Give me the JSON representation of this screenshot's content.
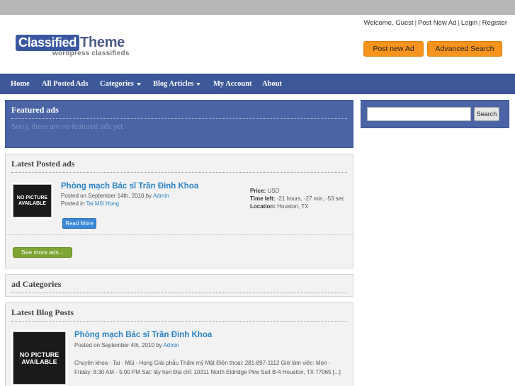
{
  "header": {
    "welcome": "Welcome, Guest",
    "links": [
      "Post New Ad",
      "Login",
      "Register"
    ],
    "logo_box": "Classified",
    "logo_word": "Theme",
    "logo_sub": "wordpress classifieds",
    "btn_post": "Post new Ad",
    "btn_advanced": "Advanced Search"
  },
  "nav": {
    "items": [
      {
        "label": "Home"
      },
      {
        "label": "All Posted Ads"
      },
      {
        "label": "Categories"
      },
      {
        "label": "Blog Articles"
      },
      {
        "label": "My Account"
      },
      {
        "label": "About"
      }
    ]
  },
  "featured": {
    "title": "Featured ads",
    "message": "Sorry, there are no featured ads yet."
  },
  "latest": {
    "title": "Latest Posted ads",
    "thumb": "NO PICTURE AVAILABLE",
    "ad_title": "Phòng mạch Bác sĩ Trần Đình Khoa",
    "posted_prefix": "Posted on September 14th, 2010 by ",
    "author": "Admin",
    "posted_in_prefix": "Posted in ",
    "category": "Tai Mũi Họng",
    "price_label": "Price:",
    "price_value": "USD",
    "time_label": "Time left:",
    "time_value": "-21 hours, -27 min, -53 sec",
    "location_label": "Location:",
    "location_value": "Houston, TX",
    "read_more": "Read More",
    "see_more": "See more ads..."
  },
  "categories": {
    "title": "ad Categories"
  },
  "blog": {
    "title": "Latest Blog Posts",
    "thumb": "NO PICTURE AVAILABLE",
    "post_title": "Phòng mạch Bác sĩ Trần Đình Khoa",
    "posted_prefix": "Posted on September 4th, 2010 by ",
    "author": "Admin",
    "excerpt": "Chuyên khoa - Tai - Mũi - Họng Giải phẫu Thẩm mỹ Mặt Điện thoại: 281-897-1112 Giờ làm việc: Mon - Friday:  8:30 AM - 5:00 PM Sat: lấy hẹn Địa chỉ: 10311 North Eldridge Pkw Suit B-4 Houston, TX 77065 [...]"
  },
  "search": {
    "value": "",
    "button": "Search"
  }
}
